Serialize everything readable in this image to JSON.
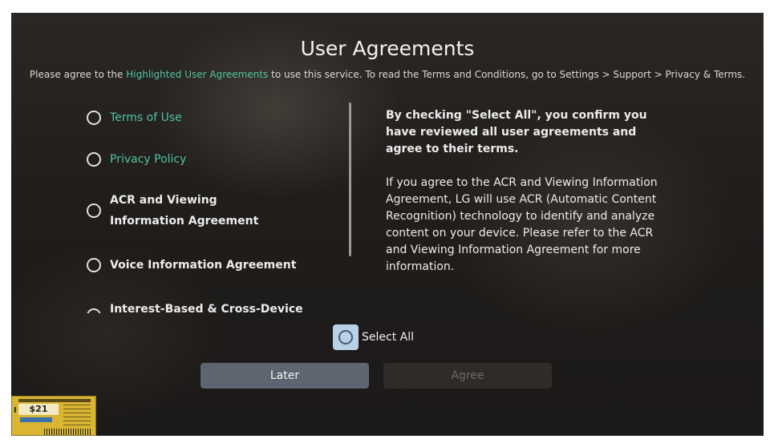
{
  "header": {
    "title": "User Agreements",
    "subtitle_pre": "Please agree to the ",
    "subtitle_highlight": "Highlighted User Agreements",
    "subtitle_post": " to use this service. To read the Terms and Conditions, go to Settings > Support > Privacy & Terms."
  },
  "agreements": {
    "items": [
      {
        "label": "Terms of Use"
      },
      {
        "label": "Privacy Policy"
      },
      {
        "label": "ACR and Viewing Information Agreement"
      },
      {
        "label": "Voice Information Agreement"
      },
      {
        "label": "Interest-Based & Cross-Device"
      }
    ]
  },
  "description": {
    "bold": "By checking \"Select All\", you confirm you have reviewed all user agreements and agree to their terms.",
    "body": "If you agree to the ACR and Viewing Information Agreement, LG will use ACR (Automatic Content Recognition) technology to identify and analyze content on your device. Please refer to the ACR and Viewing Information Agreement for more information."
  },
  "select_all": {
    "label": "Select All"
  },
  "buttons": {
    "later": "Later",
    "agree": "Agree"
  },
  "price_tag": {
    "price": "$21"
  },
  "colors": {
    "highlight": "#4fc3a1",
    "focus": "#b8d1e6",
    "later_bg": "#5d6670"
  }
}
